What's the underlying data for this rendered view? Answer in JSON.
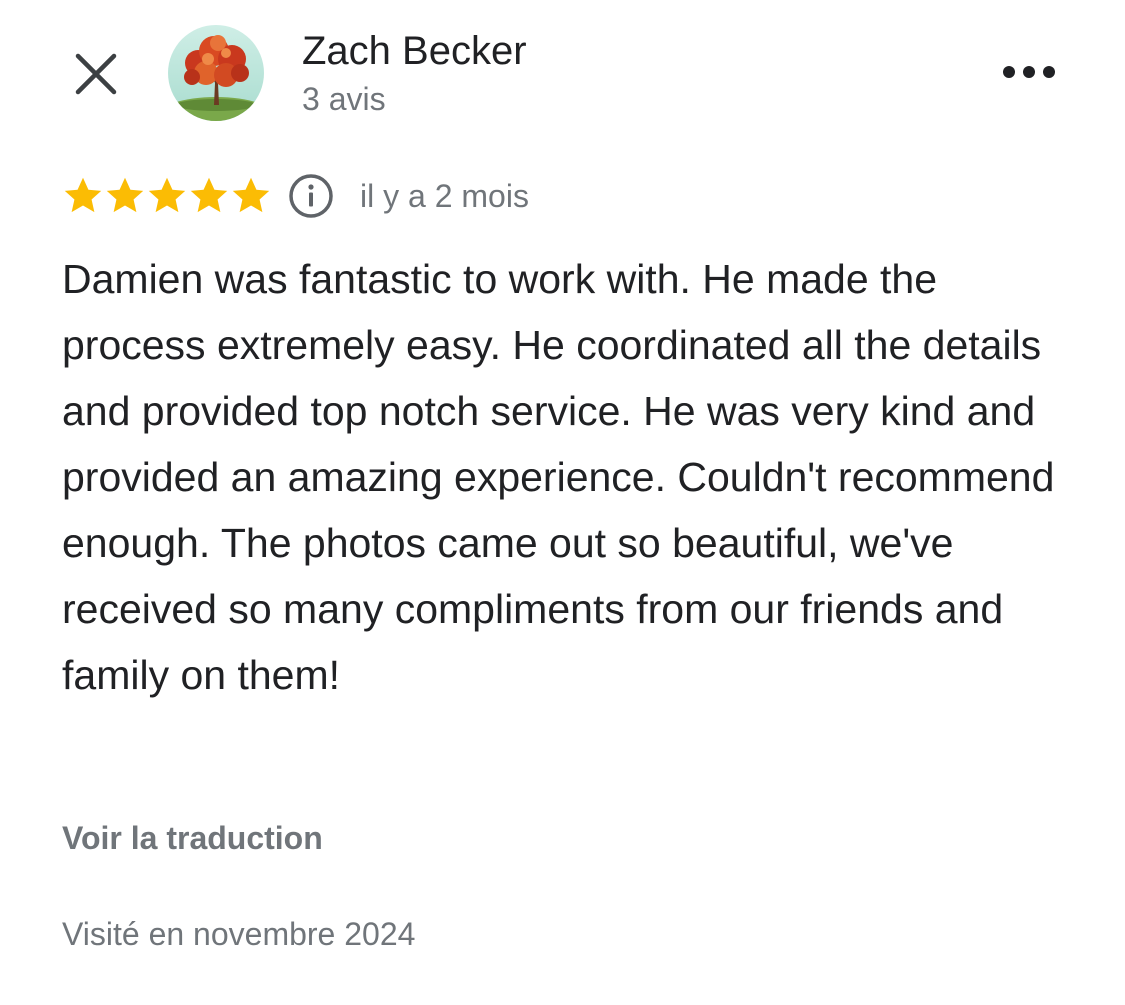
{
  "header": {
    "author_name": "Zach Becker",
    "review_count": "3 avis",
    "close_icon": "close-icon",
    "more_icon": "more-horizontal-icon",
    "avatar_icon": "tree-avatar-icon"
  },
  "review": {
    "rating": 5,
    "rating_max": 5,
    "star_color": "#fbbc04",
    "info_icon": "info-icon",
    "time_ago": "il y a 2 mois",
    "text": "Damien was fantastic to work with. He made the process extremely easy. He coordinated all the details and provided top notch service. He was very kind and provided an amazing experience. Couldn't recommend enough. The photos came out so beautiful, we've received so many compliments from our friends and family on them!",
    "translate_label": "Voir la traduction",
    "visited_label": "Visité en novembre 2024"
  },
  "colors": {
    "primary_text": "#202124",
    "secondary_text": "#70757a",
    "star": "#fbbc04"
  }
}
